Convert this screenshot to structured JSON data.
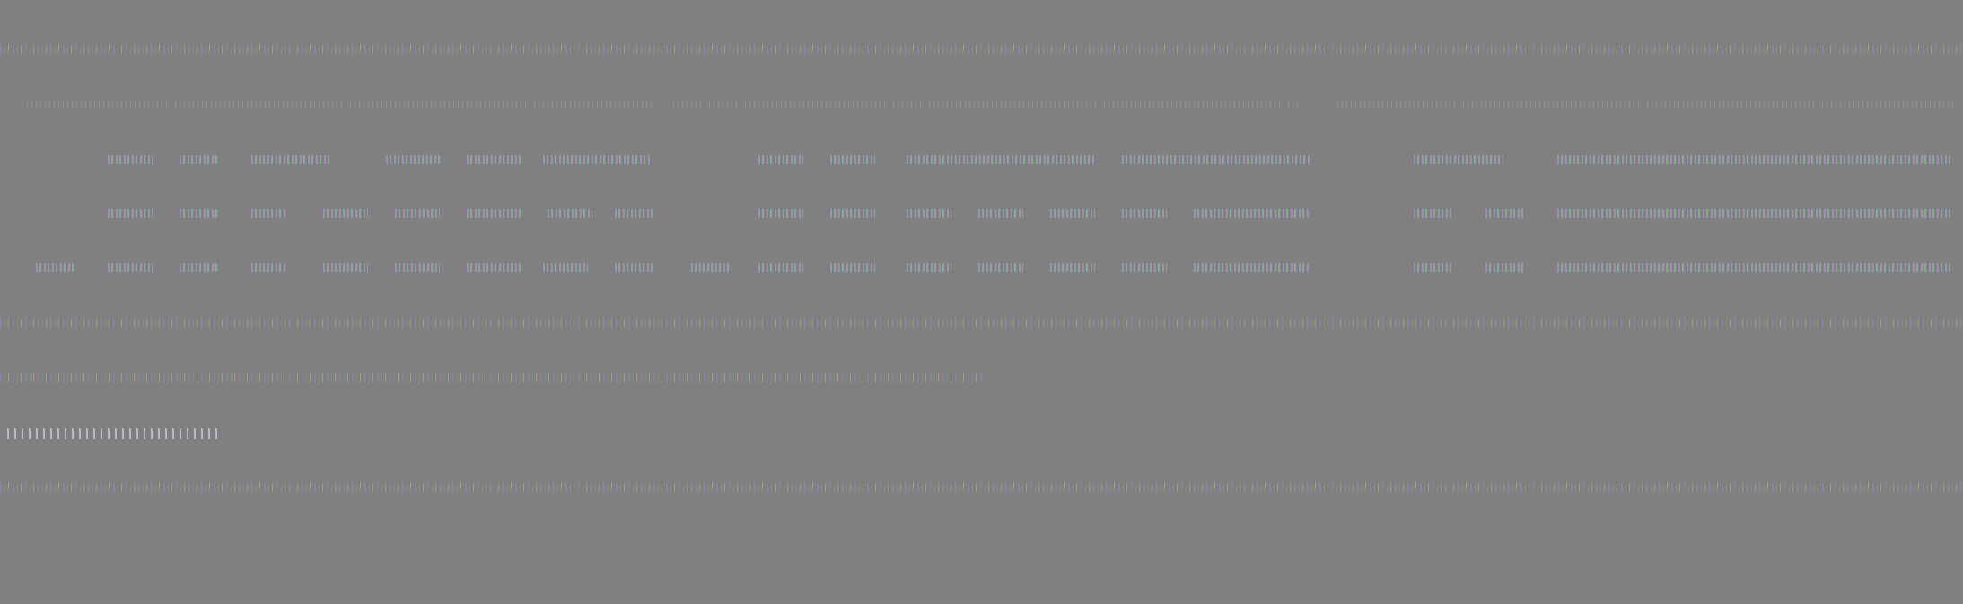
{
  "screen": {
    "background_color": "#808080",
    "content_state": "unreadable"
  }
}
